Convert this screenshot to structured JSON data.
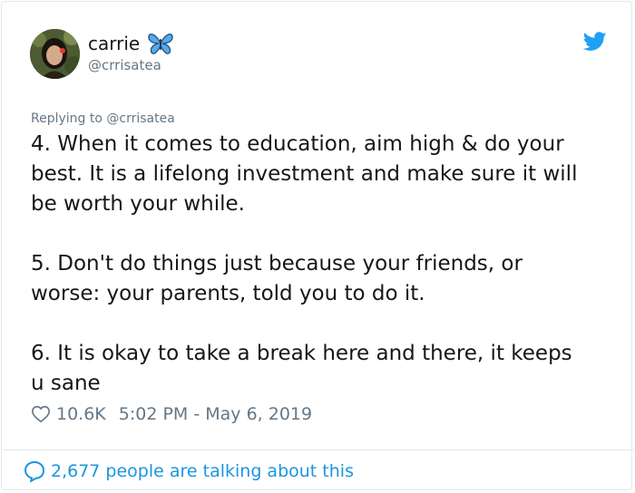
{
  "author": {
    "display_name": "carrie",
    "handle": "@crrisatea",
    "avatar_icon": "profile-photo",
    "name_emoji": "butterfly-icon"
  },
  "brand": {
    "icon": "twitter-bird-icon",
    "color": "#1da1f2"
  },
  "reply": {
    "text": "Replying to @crrisatea"
  },
  "tweet": {
    "text": "4. When it comes to education, aim high & do your\nbest. It is a lifelong investment and make sure it will\nbe worth your while.\n\n5. Don't do things just because your friends, or\nworse: your parents, told you to do it.\n\n6. It is okay to take a break here and there, it keeps\nu sane"
  },
  "meta": {
    "likes": "10.6K",
    "timestamp": "5:02 PM - May 6, 2019"
  },
  "footer": {
    "conversation": "2,677 people are talking about this",
    "accent_color": "#1b95e0"
  }
}
